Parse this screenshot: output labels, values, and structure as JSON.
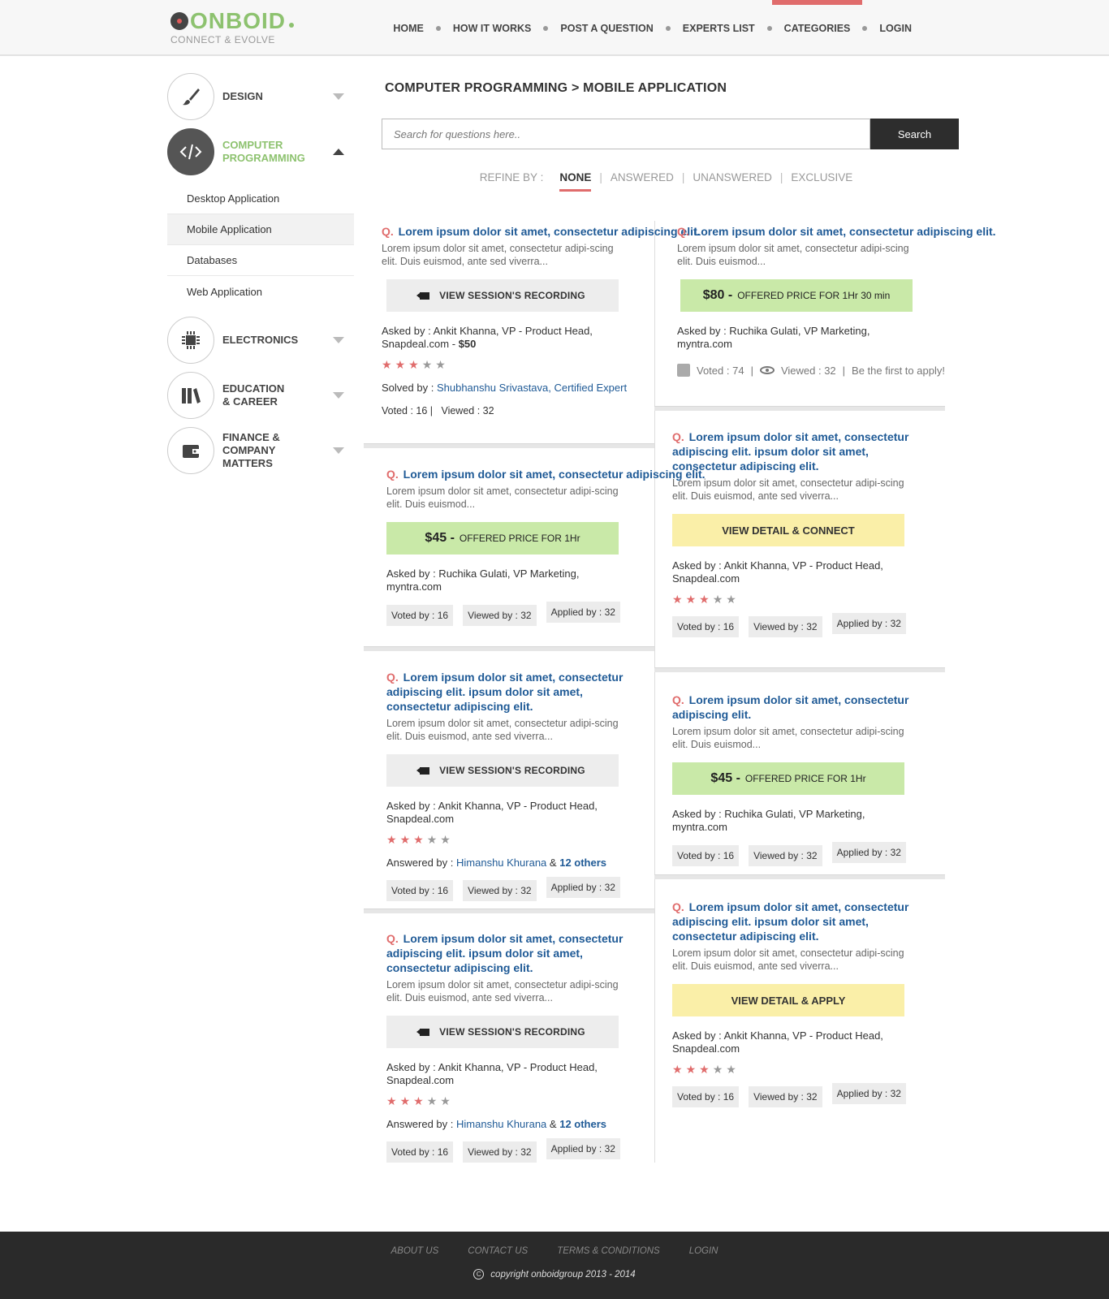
{
  "header": {
    "logo_text": "ONBOID",
    "tagline": "CONNECT & EVOLVE",
    "nav": [
      "HOME",
      "HOW IT WORKS",
      "POST A QUESTION",
      "EXPERTS LIST",
      "CATEGORIES",
      "LOGIN"
    ],
    "active_nav": "CATEGORIES"
  },
  "sidebar": {
    "categories": [
      {
        "label": "DESIGN",
        "icon": "brush-icon"
      },
      {
        "label": "COMPUTER PROGRAMMING",
        "icon": "code-icon",
        "expanded": true
      },
      {
        "label": "ELECTRONICS",
        "icon": "chip-icon"
      },
      {
        "label": "EDUCATION & CAREER",
        "icon": "books-icon"
      },
      {
        "label": "FINANCE & COMPANY MATTERS",
        "icon": "wallet-icon"
      }
    ],
    "cat_design": "DESIGN",
    "cat_cp_1": "COMPUTER",
    "cat_cp_2": "PROGRAMMING",
    "cat_elec": "ELECTRONICS",
    "cat_edu_1": "EDUCATION",
    "cat_edu_2": "& CAREER",
    "cat_fin_1": "FINANCE &",
    "cat_fin_2": "COMPANY MATTERS",
    "sub_items": [
      "Desktop Application",
      "Mobile Application",
      "Databases",
      "Web Application"
    ],
    "active_sub": "Mobile Application"
  },
  "main": {
    "breadcrumb": "COMPUTER PROGRAMMING > MOBILE APPLICATION",
    "search_placeholder": "Search for questions here..",
    "search_button": "Search",
    "refine_label": "REFINE BY :",
    "refine_options": [
      "NONE",
      "ANSWERED",
      "UNANSWERED",
      "EXCLUSIVE"
    ],
    "refine_active": "NONE"
  },
  "text": {
    "q": "Q.",
    "title_short": "Lorem ipsum dolor sit amet, consectetur adipiscing elit.",
    "title_long": "Lorem ipsum dolor sit amet, consectetur adipiscing elit. ipsum dolor sit amet, consectetur adipiscing elit.",
    "desc_a": "Lorem ipsum dolor sit amet, consectetur adipi-scing elit. Duis euismod, ante sed viverra...",
    "desc_b": "Lorem ipsum dolor sit amet, consectetur adipi-scing elit. Duis euismod...",
    "rec_label": "VIEW SESSION'S RECORDING",
    "price_suffix_1hr": "OFFERED PRICE FOR 1Hr",
    "price_suffix_130": "OFFERED PRICE FOR 1Hr 30 min",
    "price_45": "$45 -",
    "price_80": "$80 -",
    "detail_connect": "VIEW DETAIL & CONNECT",
    "detail_apply": "VIEW DETAIL & APPLY",
    "asked_ankit": "Asked by : Ankit Khanna, VP - Product Head, Snapdeal.com",
    "asked_ankit_price_prefix": "Asked by : Ankit Khanna, VP - Product Head, Snapdeal.com  -",
    "asked_price": "$50",
    "asked_ruchika": "Asked by : Ruchika Gulati, VP Marketing, myntra.com",
    "solved_prefix": "Solved by :",
    "solved_by": "Shubhanshu Srivastava, Certified Expert",
    "answered_prefix": "Answered by :",
    "answered_by": "Himanshu Khurana",
    "answered_amp": "&",
    "answered_others": "12 others",
    "voted_plain": "Voted : 16  |",
    "viewed_plain": "Viewed : 32",
    "voted_by": "Voted by : 16",
    "viewed_by": "Viewed by : 32",
    "applied_by": "Applied by : 32",
    "meta_voted": "Voted : 74",
    "meta_viewed": "Viewed : 32",
    "meta_first": "Be the first to apply!",
    "sep": "|"
  },
  "footer": {
    "links": [
      "ABOUT US",
      "CONTACT US",
      "TERMS & CONDITIONS",
      "LOGIN"
    ],
    "copyright": "copyright onboidgroup 2013 - 2014",
    "copy_symbol": "C"
  },
  "colors": {
    "accent_red": "#e06c6c",
    "brand_green": "#8dc26f",
    "link_blue": "#1f5a96",
    "price_green": "#c9e9a8",
    "detail_yellow": "#faefa8"
  }
}
